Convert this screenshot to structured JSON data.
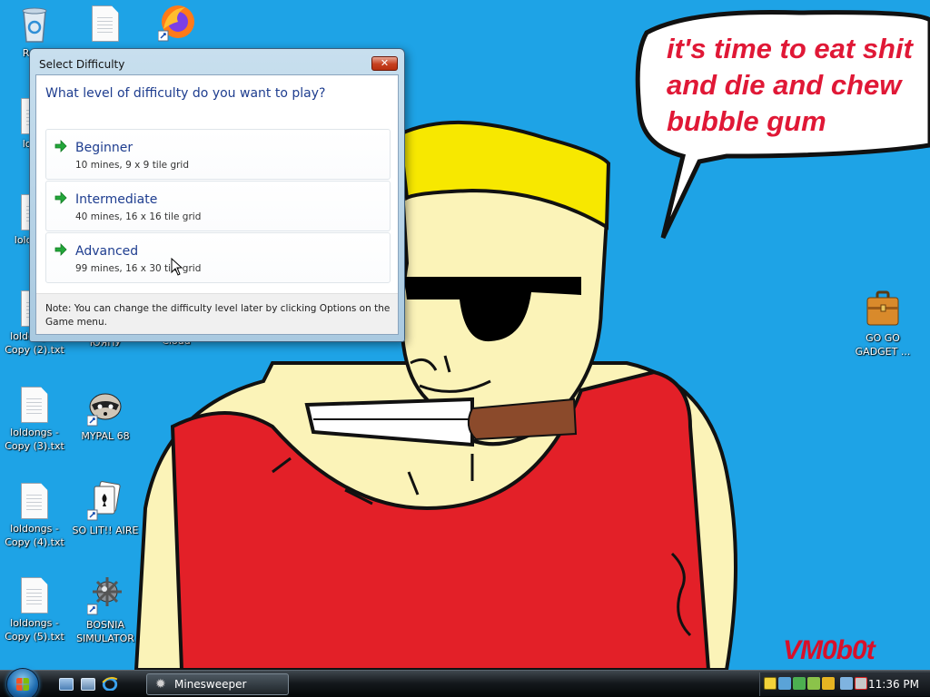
{
  "wallpaper": {
    "speech_lines": [
      "it's time to eat shit",
      "and die and chew",
      "bubble gum"
    ],
    "signature": "VM0b0t"
  },
  "desktop_icons": [
    {
      "label": "Recy",
      "icon": "recycle-bin-icon"
    },
    {
      "label": "",
      "icon": "text-file-icon"
    },
    {
      "label": "",
      "icon": "firefox-icon"
    },
    {
      "label": "loldo",
      "icon": "text-file-icon"
    },
    {
      "label": "loldo Co",
      "icon": "text-file-icon"
    },
    {
      "label": "loldongs - Copy (2).txt",
      "icon": "text-file-icon"
    },
    {
      "label": "ЮЯПУ",
      "icon": "shortcut-icon"
    },
    {
      "label": "Cloud",
      "icon": "cloud-icon"
    },
    {
      "label": "loldongs - Copy (3).txt",
      "icon": "text-file-icon"
    },
    {
      "label": "MYPAL 68",
      "icon": "raccoon-icon"
    },
    {
      "label": "loldongs - Copy (4).txt",
      "icon": "text-file-icon"
    },
    {
      "label": "SO LIT!! AIRE",
      "icon": "solitaire-icon"
    },
    {
      "label": "loldongs - Copy (5).txt",
      "icon": "text-file-icon"
    },
    {
      "label": "BOSNIA SIMULATOR",
      "icon": "mine-icon"
    },
    {
      "label": "GO GO GADGET ...",
      "icon": "briefcase-icon"
    }
  ],
  "dialog": {
    "title": "Select Difficulty",
    "close_glyph": "✕",
    "question": "What level of difficulty do you want to play?",
    "options": [
      {
        "label": "Beginner",
        "description": "10 mines, 9 x 9 tile grid"
      },
      {
        "label": "Intermediate",
        "description": "40 mines, 16 x 16 tile grid"
      },
      {
        "label": "Advanced",
        "description": "99 mines, 16 x 30 tile grid"
      }
    ],
    "note": "Note: You can change the difficulty level later by clicking Options on the Game menu."
  },
  "taskbar": {
    "active_window": "Minesweeper",
    "clock": "11:36 PM",
    "colors": {
      "accent": "#1ea3e6",
      "shirt": "#e32028",
      "hair": "#f7e800"
    }
  }
}
